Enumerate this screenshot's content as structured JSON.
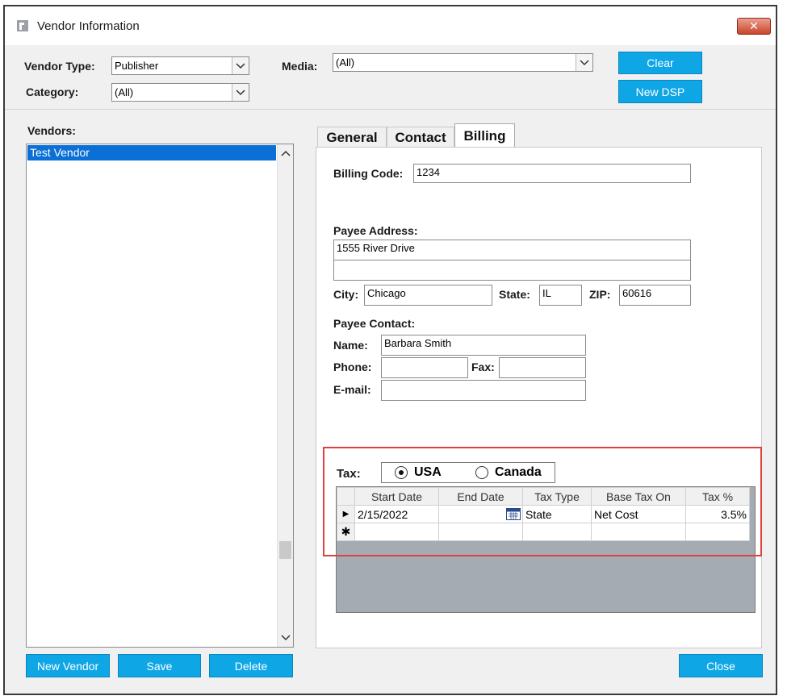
{
  "window": {
    "title": "Vendor Information",
    "close_symbol": "✕"
  },
  "filters": {
    "vendor_type_label": "Vendor Type:",
    "vendor_type_value": "Publisher",
    "category_label": "Category:",
    "category_value": "(All)",
    "media_label": "Media:",
    "media_value": "(All)"
  },
  "buttons": {
    "clear": "Clear",
    "new_dsp": "New DSP",
    "new_vendor": "New Vendor",
    "save": "Save",
    "delete": "Delete",
    "close": "Close"
  },
  "vendors": {
    "label": "Vendors:",
    "items": [
      "Test Vendor"
    ]
  },
  "tabs": [
    "General",
    "Contact",
    "Billing"
  ],
  "billing": {
    "billing_code_label": "Billing Code:",
    "billing_code": "1234",
    "payee_address_label": "Payee Address:",
    "address_line1": "1555 River Drive",
    "address_line2": "",
    "city_label": "City:",
    "city": "Chicago",
    "state_label": "State:",
    "state": "IL",
    "zip_label": "ZIP:",
    "zip": "60616",
    "payee_contact_label": "Payee Contact:",
    "name_label": "Name:",
    "name": "Barbara Smith",
    "phone_label": "Phone:",
    "phone": "",
    "fax_label": "Fax:",
    "fax": "",
    "email_label": "E-mail:",
    "email": ""
  },
  "tax": {
    "label": "Tax:",
    "options": [
      "USA",
      "Canada"
    ],
    "selected": "USA",
    "grid": {
      "columns": [
        "Start Date",
        "End Date",
        "Tax Type",
        "Base Tax On",
        "Tax %"
      ],
      "rows": [
        {
          "indicator": "▶",
          "start_date": "2/15/2022",
          "end_date": "",
          "tax_type": "State",
          "base_tax_on": "Net Cost",
          "tax_pct": "3.5%"
        }
      ],
      "new_row_indicator": "✱"
    }
  },
  "colors": {
    "accent": "#0fa6e6",
    "selection": "#0a6fd6",
    "highlight": "#e04040",
    "grid_empty": "#a4abb3"
  }
}
